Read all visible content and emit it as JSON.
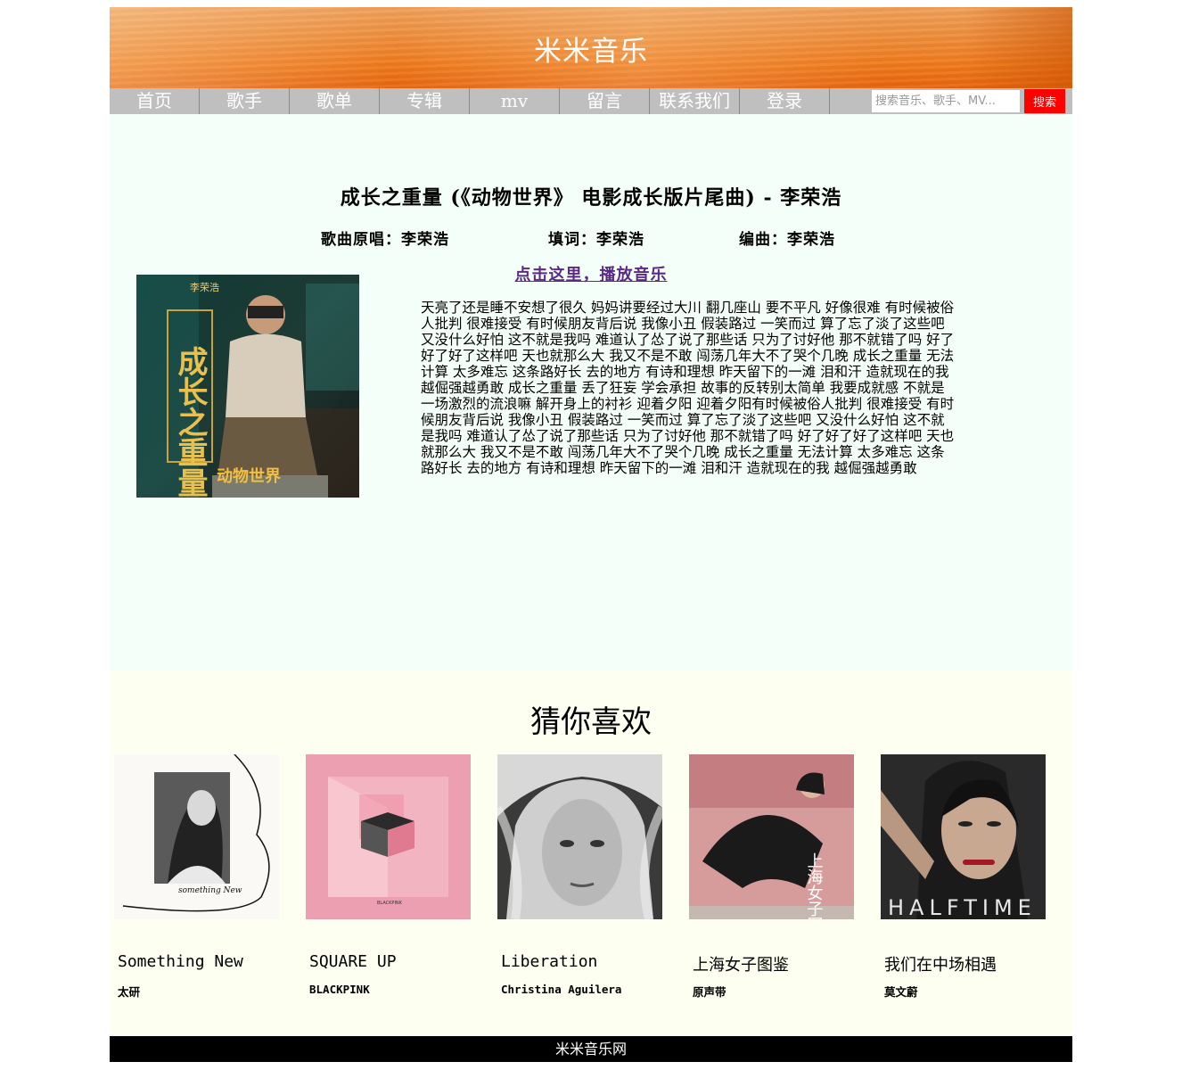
{
  "header": {
    "site_title": "米米音乐"
  },
  "nav": {
    "items": [
      "首页",
      "歌手",
      "歌单",
      "专辑",
      "mv",
      "留言",
      "联系我们",
      "登录"
    ],
    "search_placeholder": "搜索音乐、歌手、MV...",
    "search_button": "搜索"
  },
  "song": {
    "title": "成长之重量 (《动物世界》 电影成长版片尾曲) - 李荣浩",
    "singer": "歌曲原唱：李荣浩",
    "lyricist": "填词：李荣浩",
    "composer": "编曲：李荣浩",
    "play_link": "点击这里，播放音乐",
    "cover": {
      "artist_text": "李荣浩",
      "title_text": "成长之重量",
      "movie_text": "动物世界"
    },
    "lyrics": "天亮了还是睡不安想了很久 妈妈讲要经过大川 翻几座山 要不平凡 好像很难 有时候被俗人批判 很难接受 有时候朋友背后说 我像小丑 假装路过 一笑而过 算了忘了淡了这些吧 又没什么好怕 这不就是我吗 难道认了怂了说了那些话 只为了讨好他 那不就错了吗 好了好了好了这样吧 天也就那么大 我又不是不敢 闯荡几年大不了哭个几晚 成长之重量 无法计算 太多难忘 这条路好长 去的地方 有诗和理想 昨天留下的一滩 泪和汗 造就现在的我越倔强越勇敢 成长之重量 丢了狂妄 学会承担 故事的反转别太简单 我要成就感 不就是一场激烈的流浪嘛 解开身上的衬衫 迎着夕阳 迎着夕阳有时候被俗人批判 很难接受 有时候朋友背后说 我像小丑 假装路过 一笑而过 算了忘了淡了这些吧 又没什么好怕 这不就是我吗 难道认了怂了说了那些话 只为了讨好他 那不就错了吗 好了好了好了这样吧 天也就那么大 我又不是不敢 闯荡几年大不了哭个几晚 成长之重量 无法计算 太多难忘 这条路好长 去的地方 有诗和理想 昨天留下的一滩 泪和汗 造就现在的我 越倔强越勇敢"
  },
  "recommend": {
    "title": "猜你喜欢",
    "items": [
      {
        "name": "Something New",
        "artist": "太研",
        "cover_text": "something New"
      },
      {
        "name": "SQUARE UP",
        "artist": "BLACKPINK",
        "cover_text": "BLACKPINK"
      },
      {
        "name": "Liberation",
        "artist": "Christina Aguilera"
      },
      {
        "name": "上海女子图鉴",
        "artist": "原声带",
        "cover_text": "上海女子图鉴"
      },
      {
        "name": "我们在中场相遇",
        "artist": "莫文蔚",
        "cover_text": "HALFTIME"
      }
    ]
  },
  "footer": {
    "text": "米米音乐网"
  }
}
